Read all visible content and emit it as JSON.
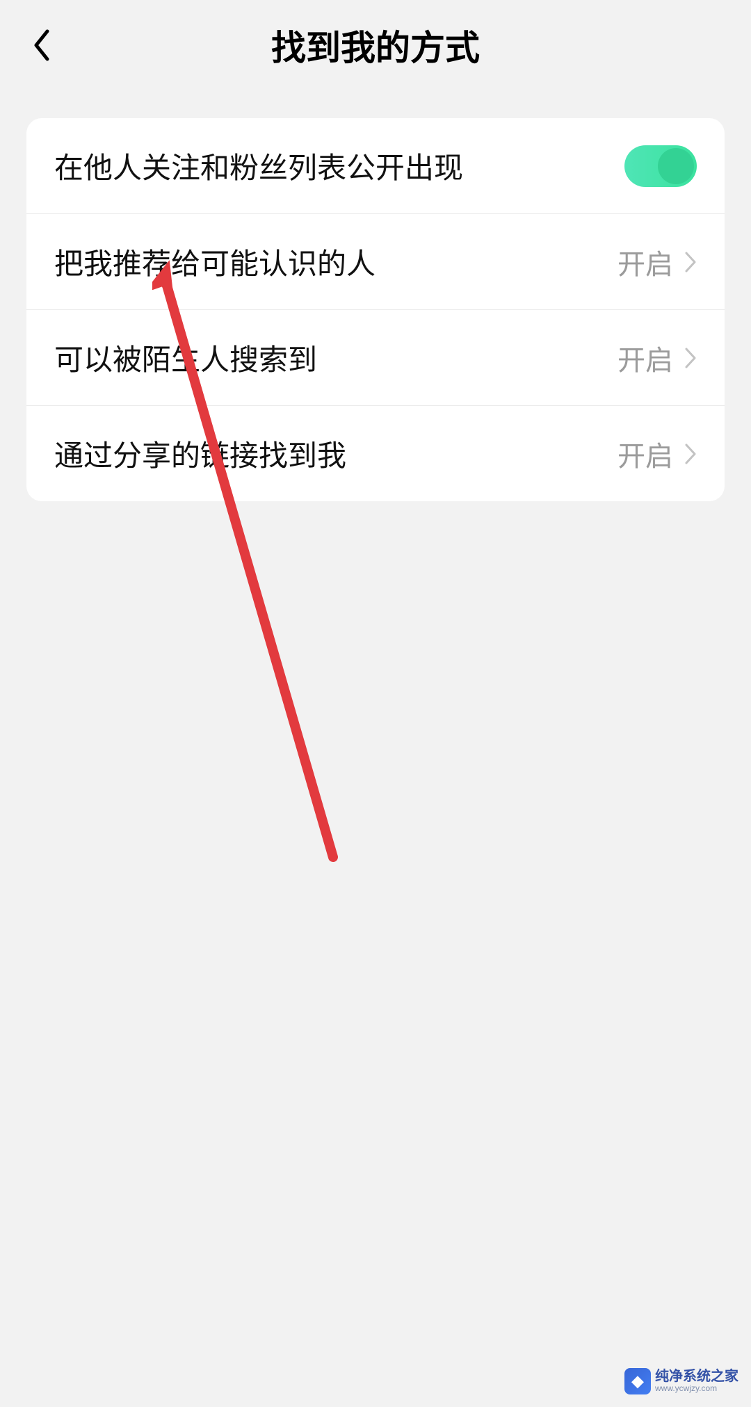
{
  "header": {
    "title": "找到我的方式"
  },
  "settings": {
    "row0": {
      "label": "在他人关注和粉丝列表公开出现",
      "toggle_on": true
    },
    "row1": {
      "label": "把我推荐给可能认识的人",
      "value": "开启"
    },
    "row2": {
      "label": "可以被陌生人搜索到",
      "value": "开启"
    },
    "row3": {
      "label": "通过分享的链接找到我",
      "value": "开启"
    }
  },
  "watermark": {
    "main": "纯净系统之家",
    "sub": "www.ycwjzy.com"
  }
}
